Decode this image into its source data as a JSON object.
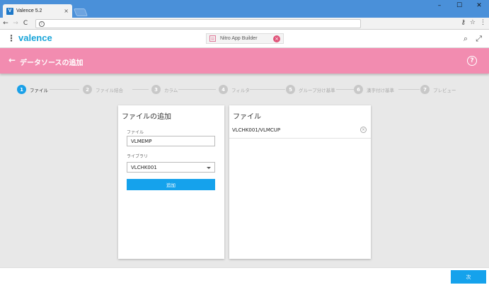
{
  "browser": {
    "tab_logo": "V",
    "tab_title": "Valence 5.2",
    "tab_close": "×",
    "win_minimize": "–",
    "win_maximize": "☐",
    "win_close": "✕",
    "nav_back": "←",
    "nav_forward": "→",
    "nav_reload": "C",
    "address_value": "",
    "key_icon": "⚷",
    "star_icon": "☆",
    "menu_icon": "⋮"
  },
  "app": {
    "brand": "valence",
    "open_app_tab": "Nitro App Builder",
    "open_app_close": "×"
  },
  "page": {
    "title": "データソースの追加",
    "help": "?"
  },
  "steps": [
    {
      "number": "1",
      "label": "ファイル",
      "active": true
    },
    {
      "number": "2",
      "label": "ファイル結合",
      "active": false
    },
    {
      "number": "3",
      "label": "カラム",
      "active": false
    },
    {
      "number": "4",
      "label": "フィルタ",
      "active": false
    },
    {
      "number": "5",
      "label": "グループ分け基準",
      "active": false
    },
    {
      "number": "6",
      "label": "漢字付け基準",
      "active": false
    },
    {
      "number": "7",
      "label": "プレビュー",
      "active": false
    }
  ],
  "add_file": {
    "title": "ファイルの追加",
    "file_label": "ファイル",
    "file_value": "VLMEMP",
    "library_label": "ライブラリ",
    "library_value": "VLCHK001",
    "add_button": "追加"
  },
  "files": {
    "title": "ファイル",
    "items": [
      "VLCHK001/VLMCUP"
    ],
    "remove_glyph": "×"
  },
  "footer": {
    "next_button": "次"
  },
  "colors": {
    "accent": "#15a2ec",
    "header_pink": "#f28cb0",
    "brand": "#18a4d8"
  }
}
